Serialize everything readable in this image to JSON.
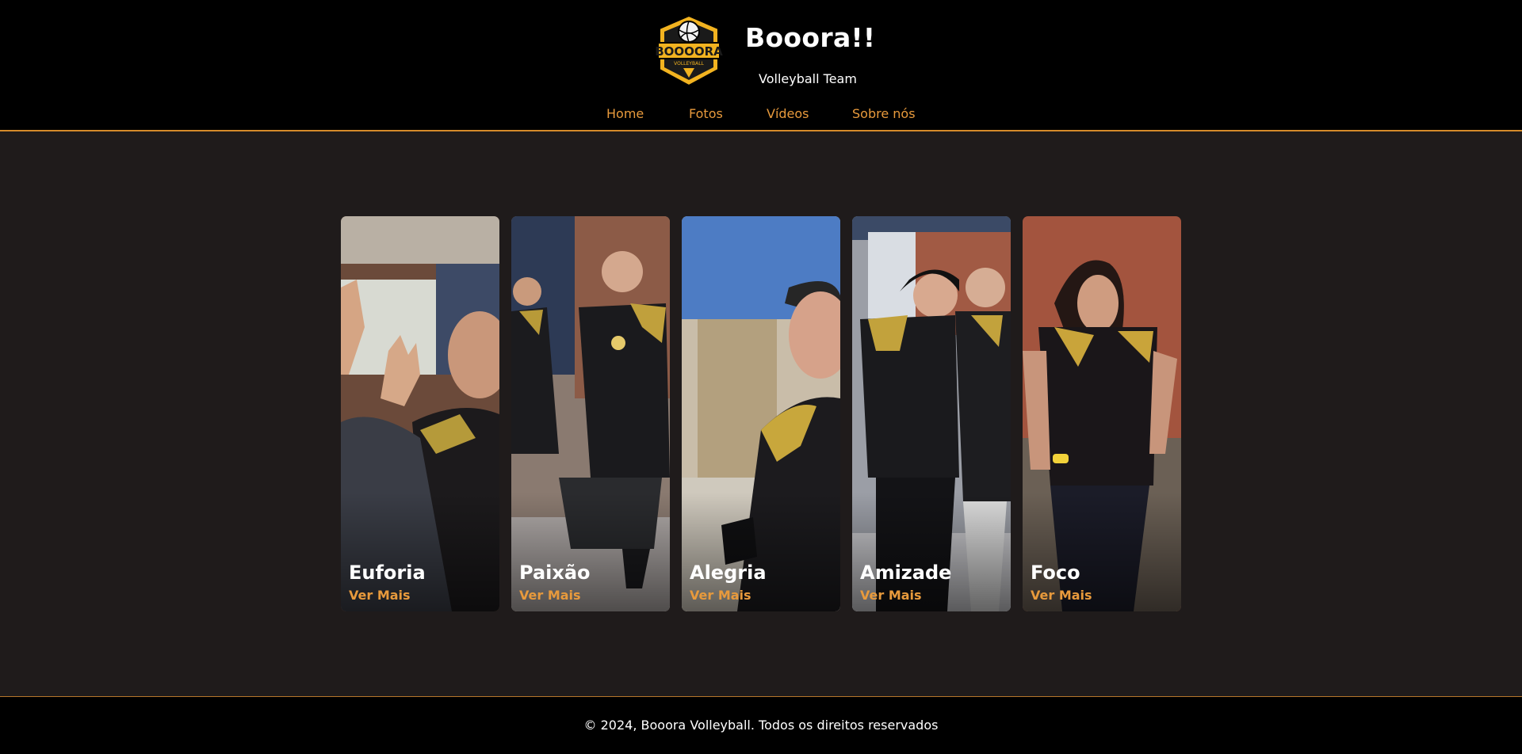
{
  "header": {
    "logo_text": "BOOOORA",
    "logo_subtext": "VOLLEYBALL",
    "title": "Booora!!",
    "subtitle": "Volleyball Team"
  },
  "nav": {
    "items": [
      {
        "label": "Home"
      },
      {
        "label": "Fotos"
      },
      {
        "label": "Vídeos"
      },
      {
        "label": "Sobre nós"
      }
    ]
  },
  "cards": [
    {
      "title": "Euforia",
      "link": "Ver Mais"
    },
    {
      "title": "Paixão",
      "link": "Ver Mais"
    },
    {
      "title": "Alegria",
      "link": "Ver Mais"
    },
    {
      "title": "Amizade",
      "link": "Ver Mais"
    },
    {
      "title": "Foco",
      "link": "Ver Mais"
    }
  ],
  "footer": {
    "copyright": "© 2024, Booora Volleyball. Todos os direitos reservados"
  },
  "colors": {
    "accent": "#e89a3c",
    "background": "#1f1b1b",
    "header_bg": "#000000",
    "jersey_gold": "#c9a227"
  }
}
